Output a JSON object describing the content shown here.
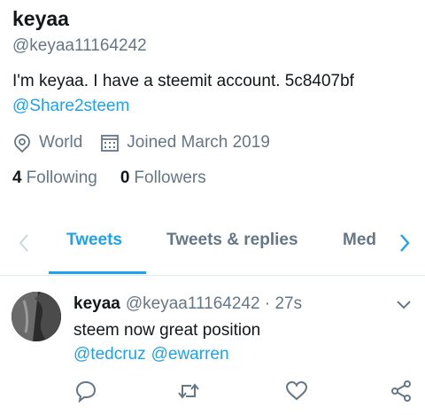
{
  "profile": {
    "display_name": "keyaa",
    "handle": "@keyaa11164242",
    "bio": "I'm keyaa. I have a steemit account. 5c8407bf",
    "bio_link": "@Share2steem",
    "location": "World",
    "joined": "Joined March 2019",
    "following_count": "4",
    "following_label": "Following",
    "followers_count": "0",
    "followers_label": "Followers"
  },
  "tabs": [
    {
      "label": "Tweets",
      "active": true
    },
    {
      "label": "Tweets & replies",
      "active": false
    },
    {
      "label": "Med",
      "active": false
    }
  ],
  "tweet": {
    "author": "keyaa",
    "handle": "@keyaa11164242",
    "separator": "·",
    "time": "27s",
    "text": "steem now great position",
    "mentions": [
      "@tedcruz",
      "@ewarren"
    ]
  },
  "icons": {
    "location": "location-pin-icon",
    "calendar": "calendar-icon",
    "reply": "reply-icon",
    "retweet": "retweet-icon",
    "like": "heart-icon",
    "share": "share-icon"
  },
  "colors": {
    "accent": "#1da1f2",
    "secondary_text": "#657786",
    "primary_text": "#14171a",
    "divider": "#e1e8ed"
  }
}
